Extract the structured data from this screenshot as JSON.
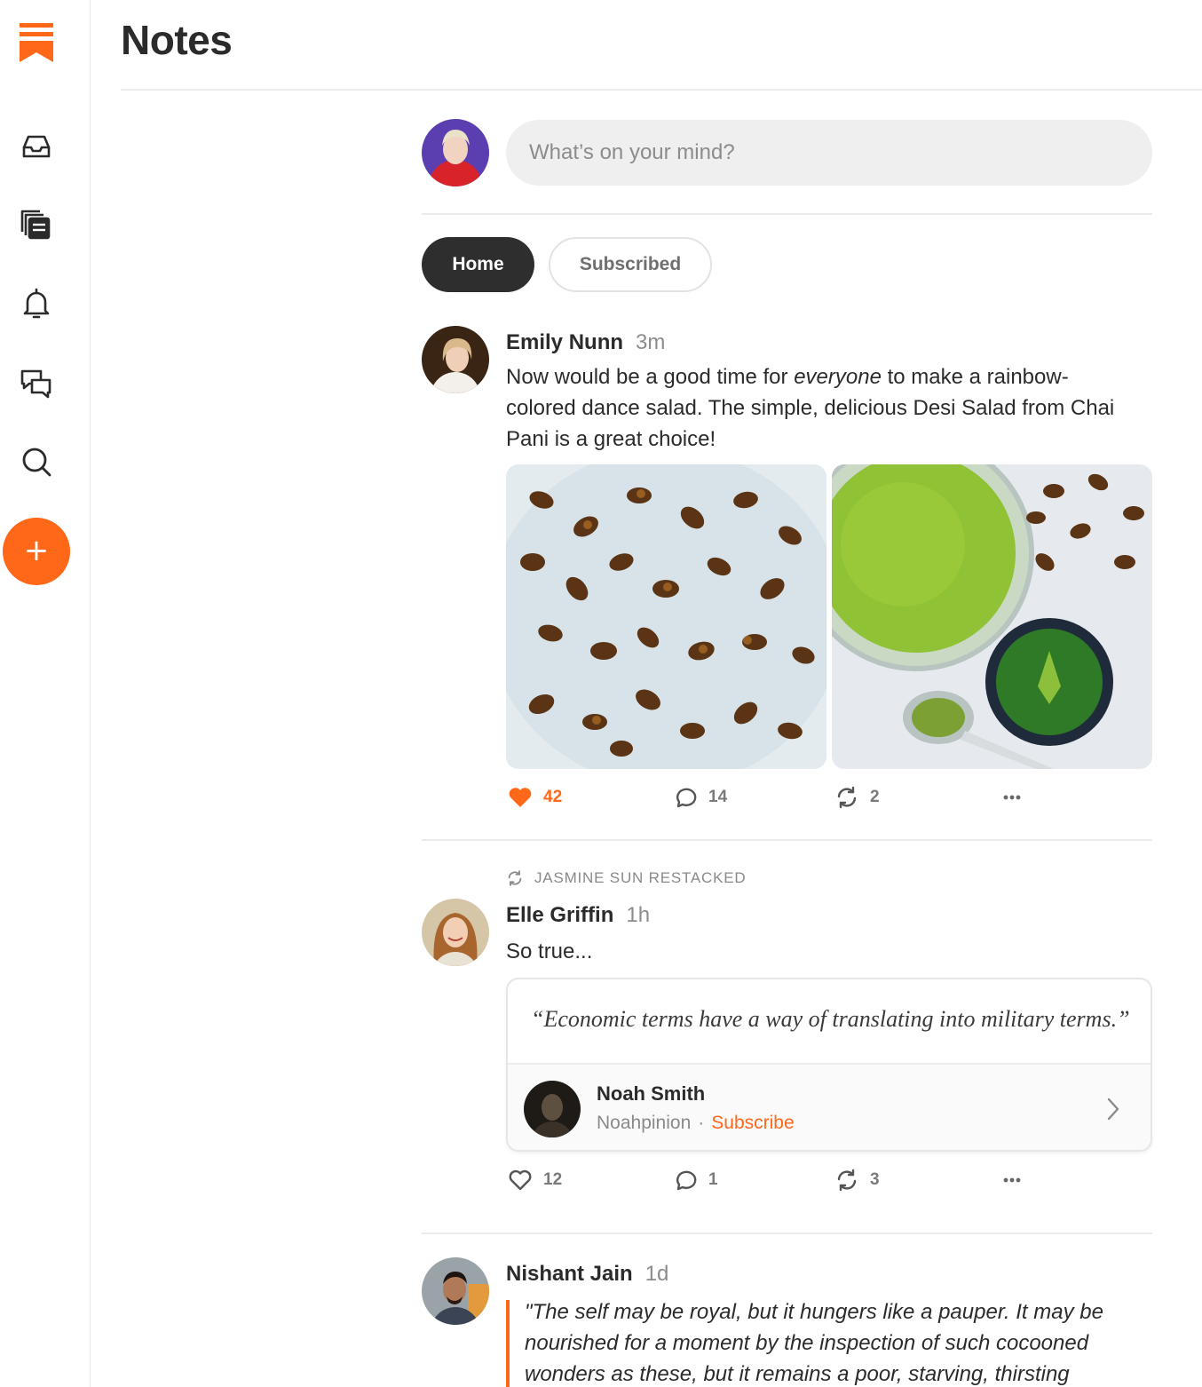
{
  "app": {
    "brand_color": "#ff6719"
  },
  "header": {
    "title": "Notes"
  },
  "sidebar": {
    "items": [
      {
        "name": "inbox",
        "icon": "inbox-icon"
      },
      {
        "name": "reader",
        "icon": "stack-icon"
      },
      {
        "name": "notifications",
        "icon": "bell-icon"
      },
      {
        "name": "chat",
        "icon": "chat-bubbles-icon"
      },
      {
        "name": "search",
        "icon": "search-icon"
      }
    ],
    "create_label": "+"
  },
  "composer": {
    "placeholder": "What’s on your mind?"
  },
  "tabs": [
    {
      "label": "Home",
      "active": true
    },
    {
      "label": "Subscribed",
      "active": false
    }
  ],
  "posts": [
    {
      "author": "Emily Nunn",
      "time": "3m",
      "text_before": "Now would be a good time for ",
      "text_em": "everyone",
      "text_after": " to make a rainbow-colored dance salad. The simple, delicious Desi Salad from Chai Pani is a great choice!",
      "likes": "42",
      "comments": "14",
      "restacks": "2",
      "liked": true
    },
    {
      "restacked_by": "JASMINE SUN RESTACKED",
      "author": "Elle Griffin",
      "time": "1h",
      "text": "So true...",
      "quote": {
        "text": "“Economic terms have a way of translating into military terms.”",
        "author": "Noah Smith",
        "publication": "Noahpinion",
        "separator": "·",
        "action": "Subscribe"
      },
      "likes": "12",
      "comments": "1",
      "restacks": "3",
      "liked": false
    },
    {
      "author": "Nishant Jain",
      "time": "1d",
      "text": "\"The self may be royal, but it hungers like a pauper. It may be nourished for a moment by the inspection of such cocooned wonders as these, but it remains a poor, starving, thirsting"
    }
  ]
}
